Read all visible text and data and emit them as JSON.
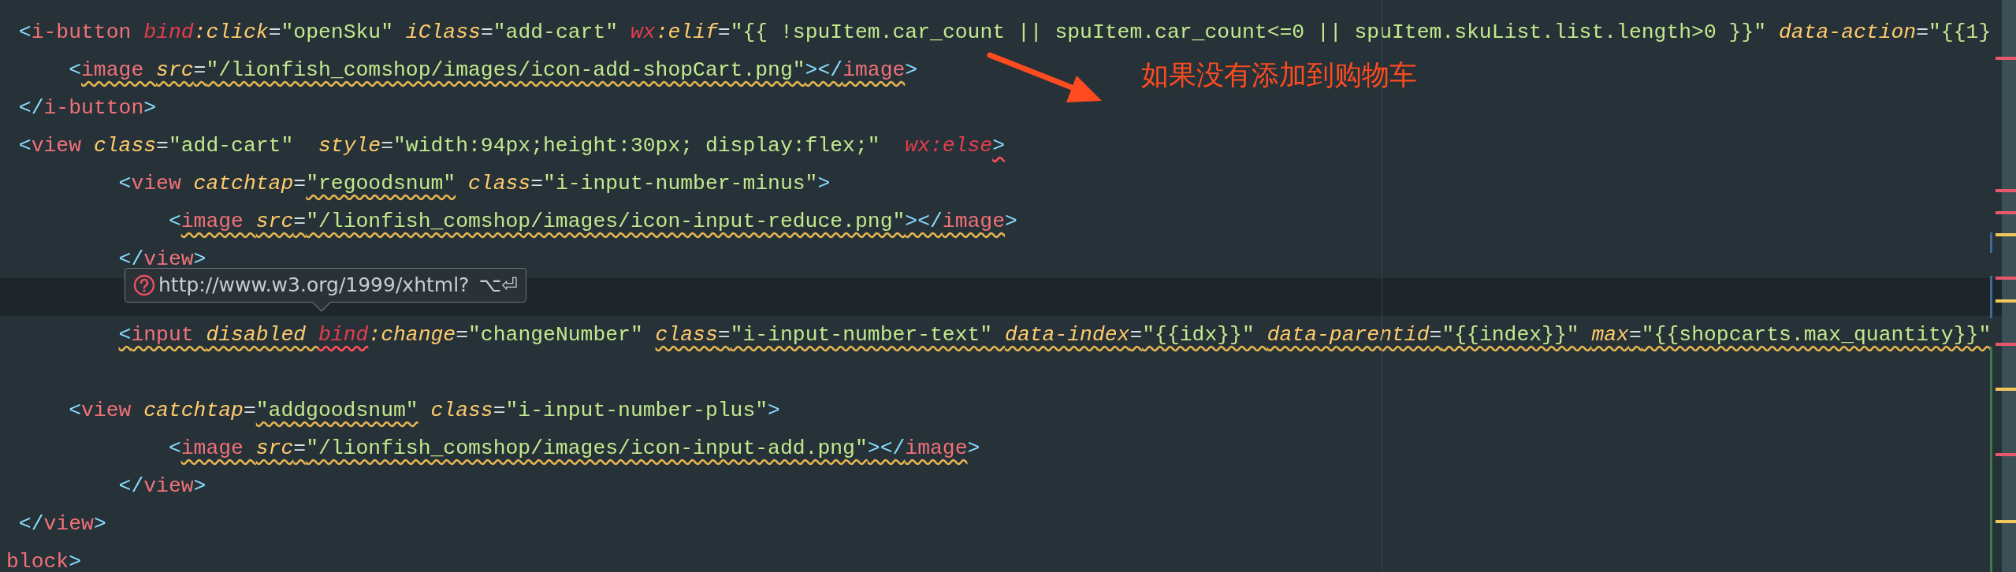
{
  "editor": {
    "lines": [
      {
        "current": false,
        "tokens": [
          {
            "kind": "punct",
            "text": " <"
          },
          {
            "kind": "tag",
            "text": "i-button "
          },
          {
            "kind": "ns",
            "text": "bind"
          },
          {
            "kind": "attr",
            "text": ":click"
          },
          {
            "kind": "op",
            "text": "="
          },
          {
            "kind": "string",
            "text": "\"openSku\" "
          },
          {
            "kind": "attr",
            "text": "iClass"
          },
          {
            "kind": "op",
            "text": "="
          },
          {
            "kind": "string",
            "text": "\"add-cart\" "
          },
          {
            "kind": "ns",
            "text": "wx"
          },
          {
            "kind": "attr",
            "text": ":elif"
          },
          {
            "kind": "op",
            "text": "="
          },
          {
            "kind": "string",
            "text": "\"{{ !spuItem.car_count || spuItem.car_count<=0 || spuItem.skuList.list.length>0 }}\" "
          },
          {
            "kind": "attr",
            "text": "data-action"
          },
          {
            "kind": "op",
            "text": "="
          },
          {
            "kind": "string",
            "text": "\"{{1}"
          }
        ]
      },
      {
        "current": false,
        "tokens": [
          {
            "kind": "punct",
            "text": "     <"
          },
          {
            "kind": "tag",
            "text": "image ",
            "warning": true
          },
          {
            "kind": "attr",
            "text": "src",
            "warning": true
          },
          {
            "kind": "op",
            "text": "=",
            "warning": true
          },
          {
            "kind": "string",
            "text": "\"/lionfish_comshop/images/icon-add-shopCart.png\"",
            "warning": true
          },
          {
            "kind": "punct",
            "text": "></",
            "warning": true
          },
          {
            "kind": "tag",
            "text": "image",
            "warning": true
          },
          {
            "kind": "punct",
            "text": ">"
          }
        ]
      },
      {
        "current": false,
        "tokens": [
          {
            "kind": "punct",
            "text": " </"
          },
          {
            "kind": "tag",
            "text": "i-button"
          },
          {
            "kind": "punct",
            "text": ">"
          }
        ]
      },
      {
        "current": false,
        "tokens": [
          {
            "kind": "punct",
            "text": " <"
          },
          {
            "kind": "tag",
            "text": "view "
          },
          {
            "kind": "attr",
            "text": "class"
          },
          {
            "kind": "op",
            "text": "="
          },
          {
            "kind": "string",
            "text": "\"add-cart\"  "
          },
          {
            "kind": "attr",
            "text": "style"
          },
          {
            "kind": "op",
            "text": "="
          },
          {
            "kind": "string",
            "text": "\"width:94px;height:30px; display:flex;\"  "
          },
          {
            "kind": "ns",
            "text": "wx:else"
          },
          {
            "kind": "punct",
            "text": ">",
            "error": true
          }
        ]
      },
      {
        "current": false,
        "tokens": [
          {
            "kind": "punct",
            "text": "         <"
          },
          {
            "kind": "tag",
            "text": "view "
          },
          {
            "kind": "attr",
            "text": "catchtap"
          },
          {
            "kind": "op",
            "text": "="
          },
          {
            "kind": "string",
            "text": "\"regoodsnum\"",
            "warning": true
          },
          {
            "kind": "attr",
            "text": " class"
          },
          {
            "kind": "op",
            "text": "="
          },
          {
            "kind": "string",
            "text": "\"i-input-number-minus\""
          },
          {
            "kind": "punct",
            "text": ">"
          }
        ]
      },
      {
        "current": false,
        "tokens": [
          {
            "kind": "punct",
            "text": "             <"
          },
          {
            "kind": "tag",
            "text": "image ",
            "warning": true
          },
          {
            "kind": "attr",
            "text": "src",
            "warning": true
          },
          {
            "kind": "op",
            "text": "=",
            "warning": true
          },
          {
            "kind": "string",
            "text": "\"/lionfish_comshop/images/icon-input-reduce.png\"",
            "warning": true
          },
          {
            "kind": "punct",
            "text": "></",
            "warning": true
          },
          {
            "kind": "tag",
            "text": "image",
            "warning": true
          },
          {
            "kind": "punct",
            "text": ">"
          }
        ]
      },
      {
        "current": false,
        "tokens": [
          {
            "kind": "punct",
            "text": "         </"
          },
          {
            "kind": "tag",
            "text": "view"
          },
          {
            "kind": "punct",
            "text": ">"
          }
        ]
      },
      {
        "current": true
      },
      {
        "current": false,
        "tokens": [
          {
            "kind": "punct",
            "text": "         <",
            "warning": true
          },
          {
            "kind": "tag",
            "text": "input ",
            "warning": true
          },
          {
            "kind": "attr",
            "text": "disabled ",
            "warning": true
          },
          {
            "kind": "ns",
            "text": "bind",
            "error": true
          },
          {
            "kind": "attr",
            "text": ":change"
          },
          {
            "kind": "op",
            "text": "="
          },
          {
            "kind": "string",
            "text": "\"changeNumber\" "
          },
          {
            "kind": "attr",
            "text": "class",
            "warning": true
          },
          {
            "kind": "op",
            "text": "=",
            "warning": true
          },
          {
            "kind": "string",
            "text": "\"i-input-number-text\" ",
            "warning": true
          },
          {
            "kind": "attr",
            "text": "data-index",
            "warning": true
          },
          {
            "kind": "op",
            "text": "=",
            "warning": true
          },
          {
            "kind": "string",
            "text": "\"{{idx}}\" ",
            "warning": true
          },
          {
            "kind": "attr",
            "text": "data-parentid",
            "warning": true
          },
          {
            "kind": "op",
            "text": "=",
            "warning": true
          },
          {
            "kind": "string",
            "text": "\"{{index}}\" ",
            "warning": true
          },
          {
            "kind": "attr",
            "text": "max",
            "warning": true
          },
          {
            "kind": "op",
            "text": "=",
            "warning": true
          },
          {
            "kind": "string",
            "text": "\"{{shopcarts.max_quantity}}\"",
            "warning": true
          }
        ]
      },
      {
        "current": false
      },
      {
        "current": false,
        "tokens": [
          {
            "kind": "punct",
            "text": "     <"
          },
          {
            "kind": "tag",
            "text": "view "
          },
          {
            "kind": "attr",
            "text": "catchtap"
          },
          {
            "kind": "op",
            "text": "="
          },
          {
            "kind": "string",
            "text": "\"addgoodsnum\"",
            "warning": true
          },
          {
            "kind": "attr",
            "text": " class"
          },
          {
            "kind": "op",
            "text": "="
          },
          {
            "kind": "string",
            "text": "\"i-input-number-plus\""
          },
          {
            "kind": "punct",
            "text": ">"
          }
        ]
      },
      {
        "current": false,
        "tokens": [
          {
            "kind": "punct",
            "text": "             <"
          },
          {
            "kind": "tag",
            "text": "image ",
            "warning": true
          },
          {
            "kind": "attr",
            "text": "src",
            "warning": true
          },
          {
            "kind": "op",
            "text": "=",
            "warning": true
          },
          {
            "kind": "string",
            "text": "\"/lionfish_comshop/images/icon-input-add.png\"",
            "warning": true
          },
          {
            "kind": "punct",
            "text": "></",
            "warning": true
          },
          {
            "kind": "tag",
            "text": "image",
            "warning": true
          },
          {
            "kind": "punct",
            "text": ">"
          }
        ]
      },
      {
        "current": false,
        "tokens": [
          {
            "kind": "punct",
            "text": "         </"
          },
          {
            "kind": "tag",
            "text": "view"
          },
          {
            "kind": "punct",
            "text": ">"
          }
        ]
      },
      {
        "current": false,
        "tokens": [
          {
            "kind": "punct",
            "text": " </"
          },
          {
            "kind": "tag",
            "text": "view"
          },
          {
            "kind": "punct",
            "text": ">"
          }
        ]
      },
      {
        "current": false,
        "tokens": [
          {
            "kind": "tag",
            "text": "block"
          },
          {
            "kind": "punct",
            "text": ">"
          }
        ]
      }
    ]
  },
  "tooltip": {
    "text": "http://www.w3.org/1999/xhtml?",
    "shortcut": "⌥⏎"
  },
  "annotation": {
    "text": "如果没有添加到购物车"
  }
}
